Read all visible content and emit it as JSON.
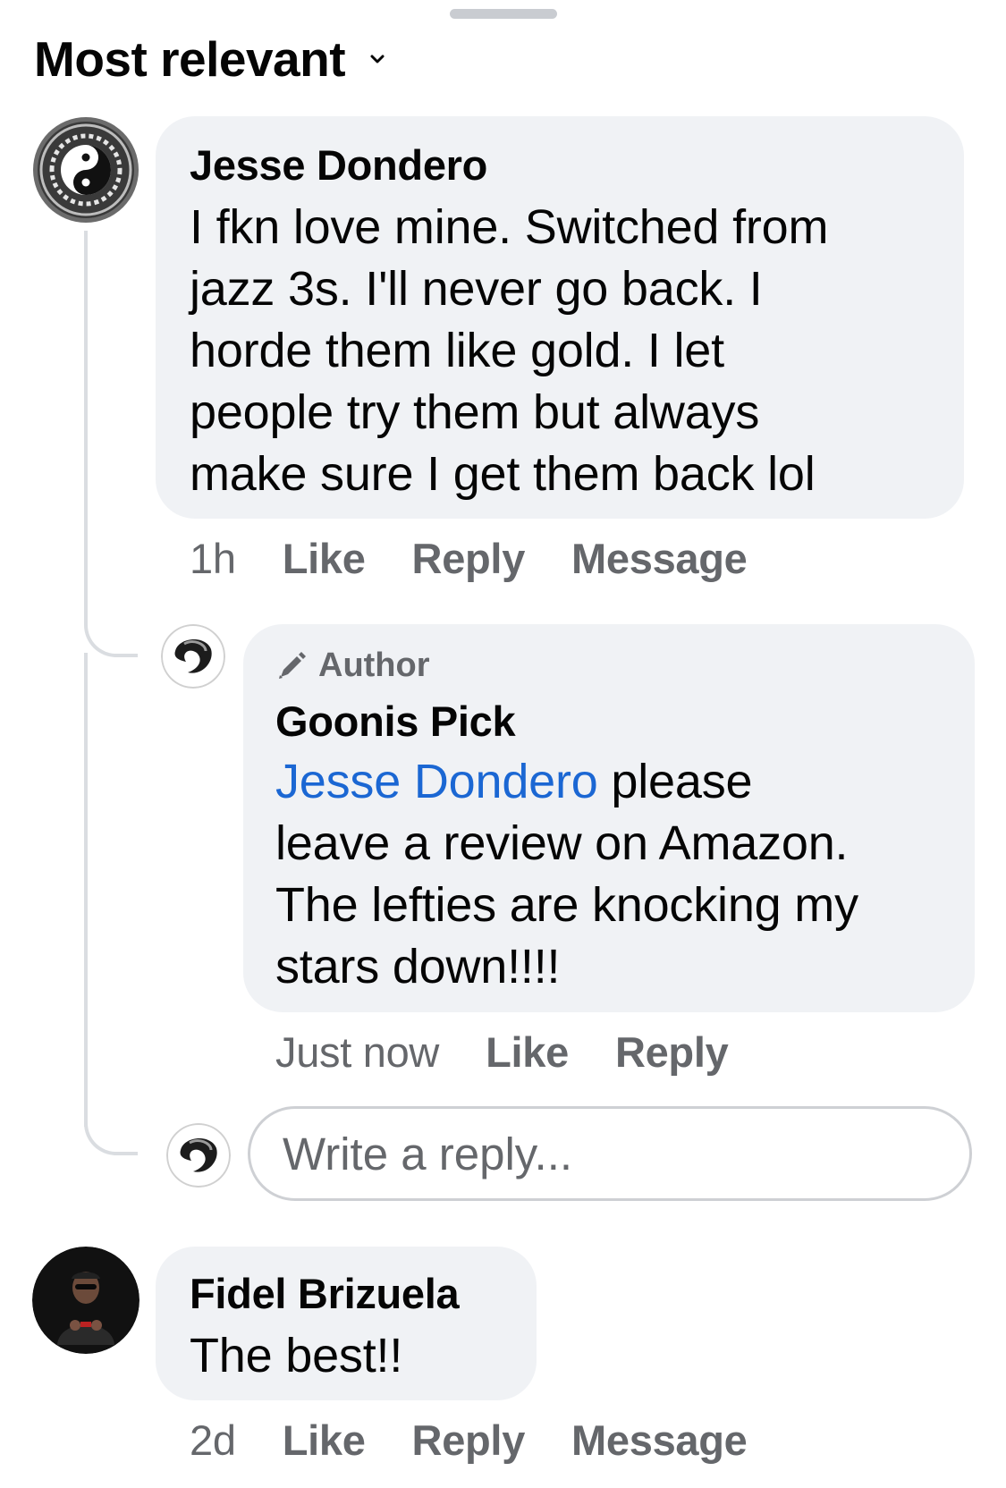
{
  "sort": {
    "label": "Most relevant"
  },
  "comments": [
    {
      "author": "Jesse Dondero",
      "text_lines": [
        "I fkn love mine.  Switched from",
        "jazz 3s. I'll never go back. I",
        "horde them like gold. I let",
        "people try them but always",
        "make sure I get them back lol"
      ],
      "time": "1h",
      "like": "Like",
      "reply": "Reply",
      "message": "Message",
      "avatar_icon": "yin-yang-logo-avatar",
      "replies": [
        {
          "badge": "Author",
          "author": "Goonis Pick",
          "mention": "Jesse Dondero",
          "text_first_line_rest": " please",
          "text_lines": [
            "leave a review on Amazon.",
            "The lefties are knocking my",
            "stars down!!!!"
          ],
          "time": "Just now",
          "like": "Like",
          "reply": "Reply",
          "avatar_icon": "goonis-logo-avatar"
        }
      ],
      "reply_box": {
        "placeholder": "Write a reply..."
      }
    },
    {
      "author": "Fidel Brizuela",
      "text": "The best!!",
      "time": "2d",
      "like": "Like",
      "reply": "Reply",
      "message": "Message",
      "avatar_icon": "person-photo-avatar"
    }
  ],
  "colors": {
    "bubble": "#f0f2f5",
    "mention": "#1b67d3",
    "meta": "#65676b",
    "thread_line": "#dadde1"
  }
}
